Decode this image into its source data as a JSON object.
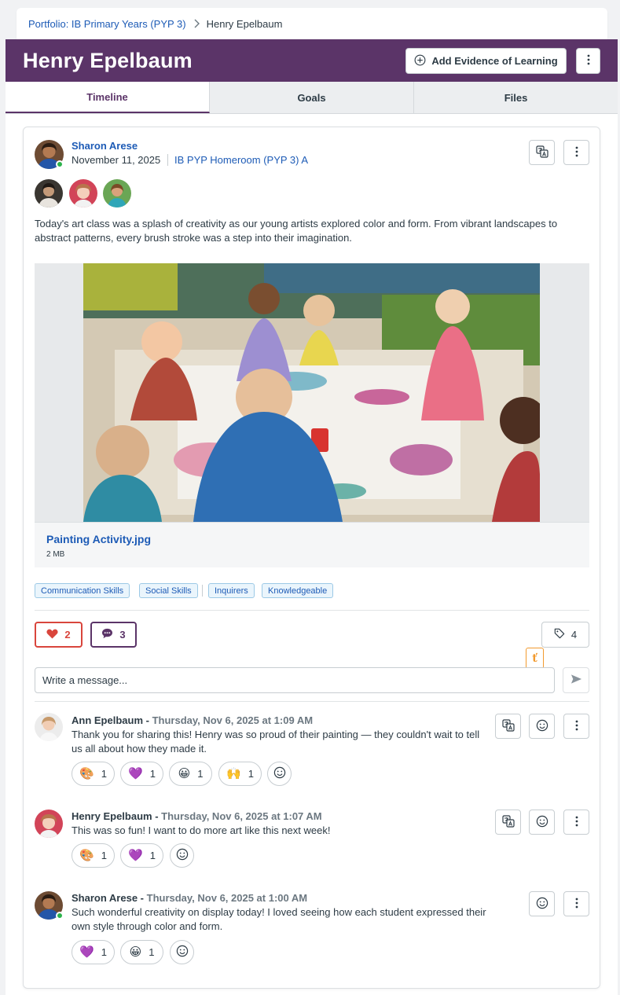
{
  "breadcrumb": {
    "parent": "Portfolio: IB Primary Years (PYP 3)",
    "current": "Henry Epelbaum"
  },
  "header": {
    "title": "Henry Epelbaum",
    "add_button": "Add Evidence of Learning"
  },
  "tabs": [
    {
      "label": "Timeline",
      "active": true
    },
    {
      "label": "Goals",
      "active": false
    },
    {
      "label": "Files",
      "active": false
    }
  ],
  "post": {
    "author": "Sharon Arese",
    "date": "November 11, 2025",
    "class": "IB PYP Homeroom (PYP 3) A",
    "text": "Today's art class was a splash of creativity as our young artists explored color and form. From vibrant landscapes to abstract patterns, every brush stroke was a step into their imagination.",
    "file": {
      "name": "Painting Activity.jpg",
      "size": "2 MB"
    },
    "tags": [
      "Communication Skills",
      "Social Skills",
      "Inquirers",
      "Knowledgeable"
    ],
    "likes": "2",
    "comments": "3",
    "tag_count": "4",
    "message_placeholder": "Write a message..."
  },
  "comments": [
    {
      "author": "Ann Epelbaum",
      "time": "Thursday, Nov 6, 2025 at 1:09 AM",
      "text": "Thank you for sharing this! Henry was so proud of their painting — they couldn't wait to tell us all about how they made it.",
      "reactions": [
        {
          "icon": "palette-emoji",
          "count": "1"
        },
        {
          "icon": "purple-heart-emoji",
          "count": "1"
        },
        {
          "icon": "grinning-face-emoji",
          "count": "1"
        },
        {
          "icon": "raising-hands-emoji",
          "count": "1"
        }
      ]
    },
    {
      "author": "Henry Epelbaum",
      "time": "Thursday, Nov 6, 2025 at 1:07 AM",
      "text": "This was so fun! I want to do more art like this next week!",
      "reactions": [
        {
          "icon": "palette-emoji",
          "count": "1"
        },
        {
          "icon": "purple-heart-emoji",
          "count": "1"
        }
      ]
    },
    {
      "author": "Sharon Arese",
      "time": "Thursday, Nov 6, 2025 at 1:00 AM",
      "text": "Such wonderful creativity on display today! I loved seeing how each student expressed their own style through color and form.",
      "reactions": [
        {
          "icon": "purple-heart-emoji",
          "count": "1"
        },
        {
          "icon": "grinning-face-emoji",
          "count": "1"
        }
      ]
    }
  ],
  "colors": {
    "brand_purple": "#5b3468",
    "link_blue": "#1d5bb6",
    "like_red": "#d9453c",
    "online_green": "#2bb34b",
    "badge_orange": "#f29a2e"
  }
}
